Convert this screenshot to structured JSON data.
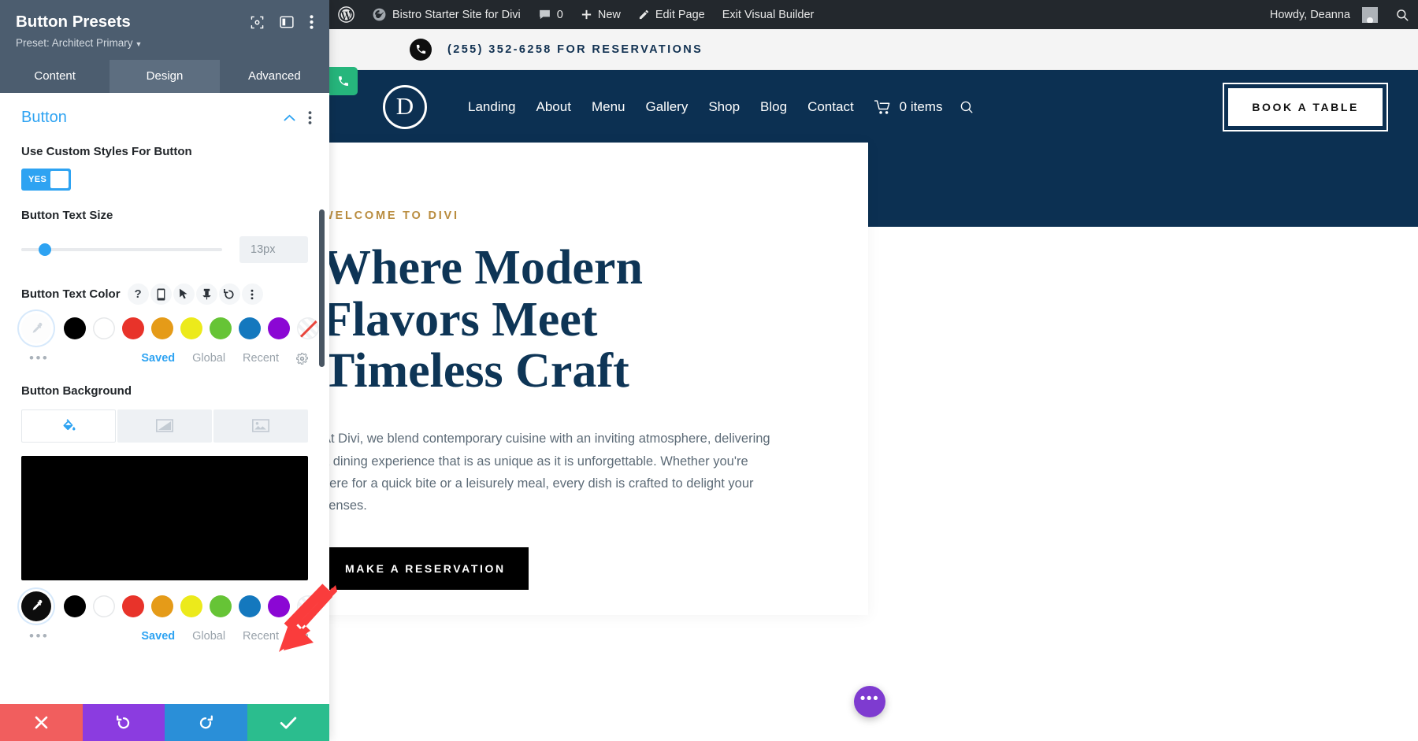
{
  "adminbar": {
    "site_name": "Bistro Starter Site for Divi",
    "comment_count": "0",
    "new_label": "New",
    "edit_page_label": "Edit Page",
    "exit_builder_label": "Exit Visual Builder",
    "howdy": "Howdy, Deanna"
  },
  "site": {
    "topbar_phone": "(255) 352-6258 FOR RESERVATIONS",
    "logo_letter": "D",
    "nav": [
      "Landing",
      "About",
      "Menu",
      "Gallery",
      "Shop",
      "Blog",
      "Contact"
    ],
    "cart_label": "0 items",
    "book_table_label": "BOOK A TABLE",
    "hero": {
      "eyebrow": "WELCOME TO DIVI",
      "title": "Where Modern Flavors Meet Timeless Craft",
      "paragraph": "At Divi, we blend contemporary cuisine with an inviting atmosphere, delivering a dining experience that is as unique as it is unforgettable. Whether you're here for a quick bite or a leisurely meal, every dish is crafted to delight your senses.",
      "cta_label": "MAKE A RESERVATION"
    },
    "fab_label": "•••"
  },
  "panel": {
    "title": "Button Presets",
    "preset_label": "Preset: Architect Primary",
    "tabs": [
      {
        "label": "Content",
        "active": false
      },
      {
        "label": "Design",
        "active": true
      },
      {
        "label": "Advanced",
        "active": false
      }
    ],
    "section": {
      "title": "Button"
    },
    "fields": {
      "custom_styles_label": "Use Custom Styles For Button",
      "custom_styles_value": "YES",
      "text_size_label": "Button Text Size",
      "text_size_value": "13px",
      "text_color_label": "Button Text Color",
      "background_label": "Button Background"
    },
    "palette_tabs": [
      {
        "label": "Saved",
        "active": true
      },
      {
        "label": "Global",
        "active": false
      },
      {
        "label": "Recent",
        "active": false
      }
    ],
    "swatches": [
      "#000000",
      "#ffffff",
      "#e8332a",
      "#e59b18",
      "#ecea1b",
      "#66c436",
      "#1478be",
      "#8b07d4",
      "none"
    ],
    "colors": {
      "accent": "#2ea3f2",
      "header_bg": "#4c5d6f",
      "preview_color": "#000000",
      "cancel": "#f15e5e",
      "undo": "#8b3ce0",
      "redo": "#2a8fd8",
      "save": "#2bbd8e"
    },
    "bottom_actions": [
      "cancel",
      "undo",
      "redo",
      "save"
    ]
  }
}
